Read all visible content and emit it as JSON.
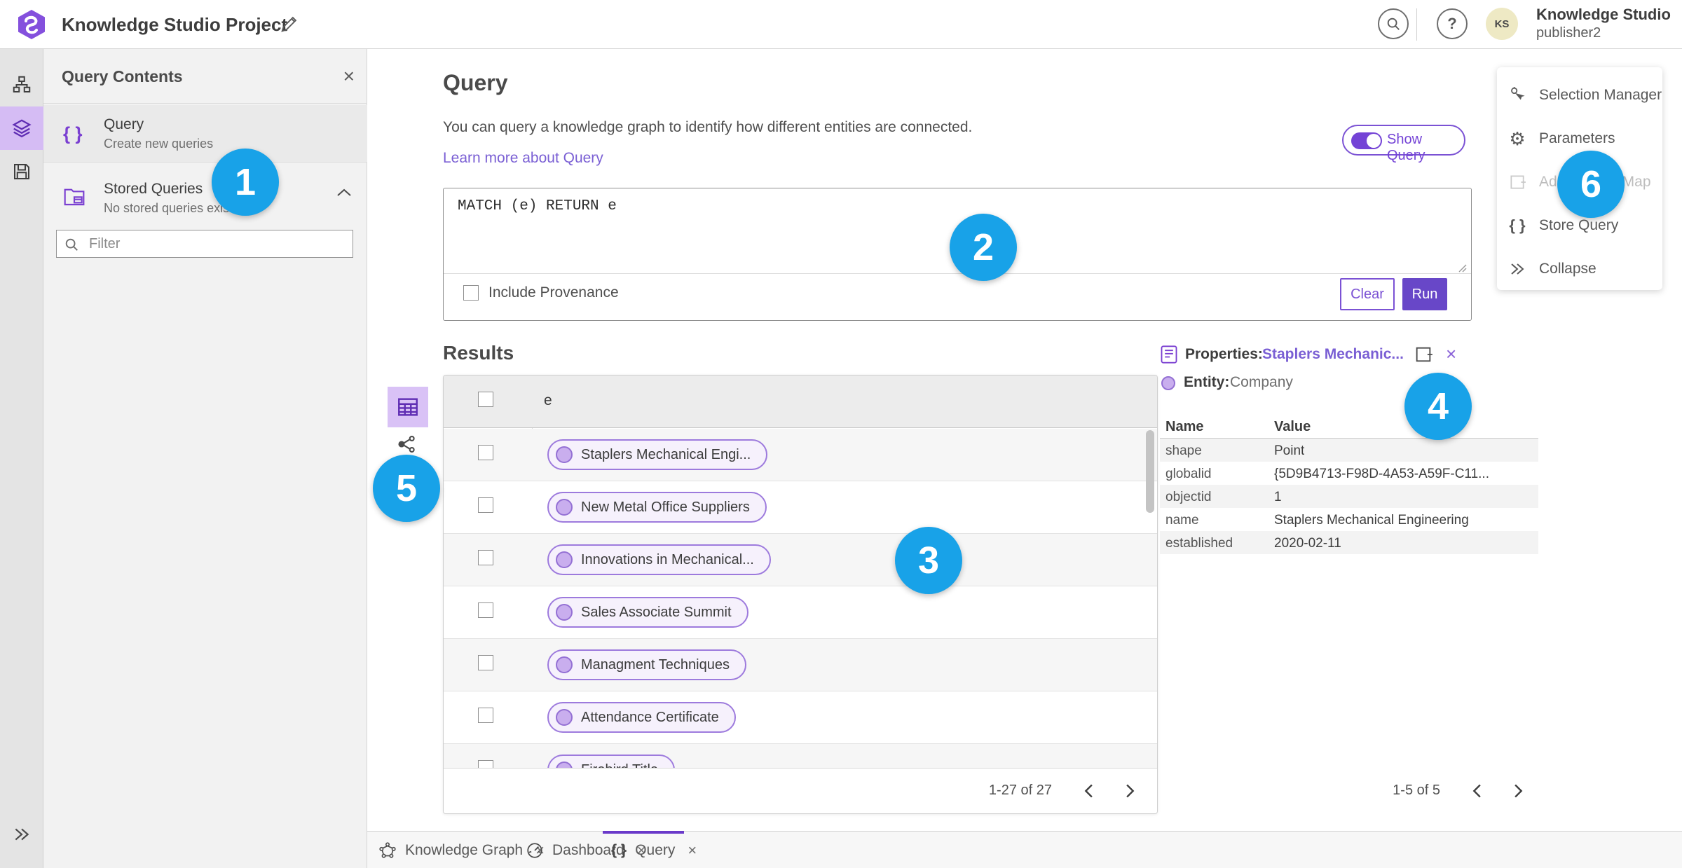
{
  "theme": {
    "accent_purple": "#6a3ac9",
    "link_purple": "#7a5fd4",
    "badge_blue": "#18a2e8",
    "chip_border": "#9d7add",
    "chip_bg": "#f6f1fc",
    "node_fill": "#c9aeee",
    "rail_selected_bg": "#d5bcf4"
  },
  "icons": {
    "close": "×",
    "question": "?",
    "gear": "⚙",
    "braces": "{ }",
    "chevron_left": "‹",
    "chevron_right": "›"
  },
  "topbar": {
    "title": "Knowledge Studio Project",
    "avatar_initials": "KS",
    "user_name": "Knowledge Studio",
    "user_role": "publisher2"
  },
  "contents": {
    "title": "Query Contents",
    "query_item": {
      "title": "Query",
      "subtitle": "Create new queries"
    },
    "stored_item": {
      "title": "Stored Queries",
      "subtitle": "No stored queries exist"
    },
    "filter_placeholder": "Filter"
  },
  "query": {
    "heading": "Query",
    "description": "You can query a knowledge graph to identify how different entities are connected.",
    "learn_link": "Learn more about Query",
    "show_query_label": "Show Query",
    "query_text": "MATCH (e) RETURN e",
    "include_provenance_label": "Include Provenance",
    "clear_label": "Clear",
    "run_label": "Run"
  },
  "results": {
    "heading": "Results",
    "column": "e",
    "rows": [
      "Staplers Mechanical Engi...",
      "New Metal Office Suppliers",
      "Innovations in Mechanical...",
      "Sales Associate Summit",
      "Managment Techniques",
      "Attendance Certificate",
      "Firebird Title"
    ],
    "pagination": "1-27 of 27"
  },
  "properties": {
    "label": "Properties:",
    "entity_link": "Staplers Mechanic...",
    "entity_label": "Entity:",
    "entity_type": "Company",
    "col_name": "Name",
    "col_value": "Value",
    "rows": [
      {
        "name": "shape",
        "value": "Point"
      },
      {
        "name": "globalid",
        "value": "{5D9B4713-F98D-4A53-A59F-C11..."
      },
      {
        "name": "objectid",
        "value": "1"
      },
      {
        "name": "name",
        "value": "Staplers Mechanical Engineering"
      },
      {
        "name": "established",
        "value": "2020-02-11"
      }
    ],
    "pagination": "1-5 of 5"
  },
  "menu": {
    "items": [
      {
        "label": "Selection Manager"
      },
      {
        "label": "Parameters"
      },
      {
        "label": "Add To New Map"
      },
      {
        "label": "Store Query"
      },
      {
        "label": "Collapse"
      }
    ]
  },
  "tabs": [
    {
      "label": "Knowledge Graph"
    },
    {
      "label": "Dashboard"
    },
    {
      "label": "Query"
    }
  ],
  "badges": [
    "1",
    "2",
    "3",
    "4",
    "5",
    "6"
  ]
}
